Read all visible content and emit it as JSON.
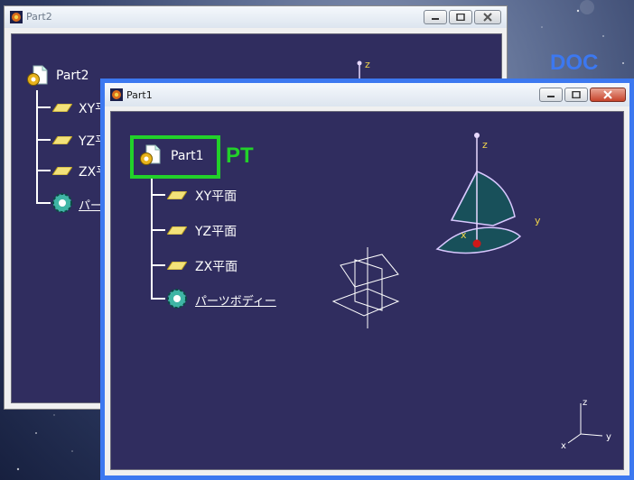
{
  "background": {
    "color": "#2e3b63"
  },
  "annotations": {
    "doc": {
      "text": "DOC",
      "color": "#3c78f0"
    },
    "pt": {
      "text": "PT",
      "color": "#22d12a"
    }
  },
  "window_back": {
    "title": "Part2",
    "tree": {
      "root": "Part2",
      "items": [
        "XY平面",
        "YZ平面",
        "ZX平面"
      ],
      "body": "パーツボディー"
    },
    "axis_labels": {
      "z": "z"
    }
  },
  "window_front": {
    "title": "Part1",
    "tree": {
      "root": "Part1",
      "items": [
        "XY平面",
        "YZ平面",
        "ZX平面"
      ],
      "body": "パーツボディー"
    },
    "axis_labels": {
      "x": "x",
      "y": "y",
      "z": "z"
    },
    "compass_labels": {
      "x": "x",
      "y": "y",
      "z": "z"
    }
  },
  "icons": {
    "window": "catia-app-icon",
    "minimize": "minimize-icon",
    "maximize": "maximize-icon",
    "close": "close-icon",
    "part": "part-document-gear-icon",
    "plane": "plane-icon",
    "body": "part-body-gear-icon"
  },
  "colors": {
    "viewport": "#302d5f",
    "highlight_box": "#22d12a",
    "active_frame": "#3c78f0",
    "close_button": "#c7442b"
  }
}
